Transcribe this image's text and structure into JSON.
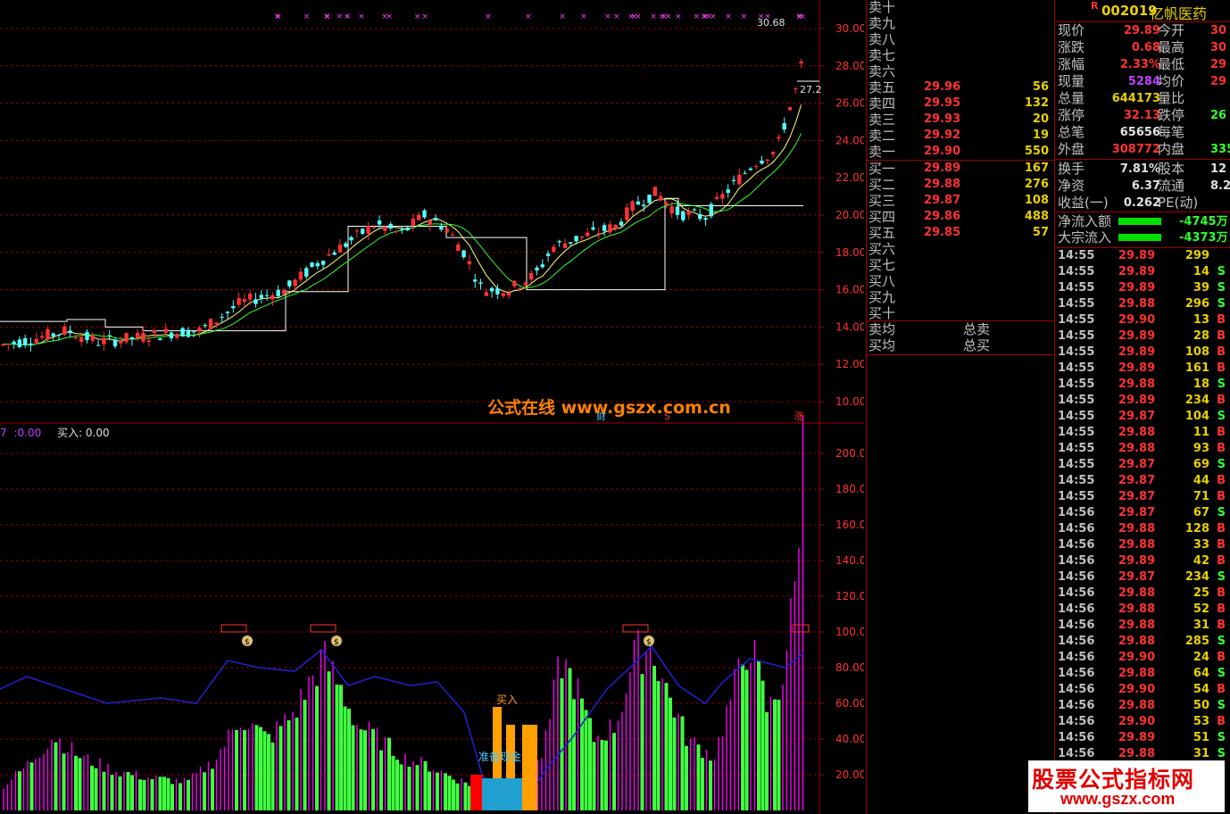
{
  "stock": {
    "flag": "R",
    "code": "002019",
    "name": "亿帆医药"
  },
  "colors": {
    "up": "#ff3232",
    "down": "#54ffff",
    "vol_up": "#ff00ff",
    "grid": "#8b0000",
    "ma1": "#ffff80",
    "ma2": "#30ff30"
  },
  "main_chart": {
    "price_axis": [
      "30.00",
      "28.00",
      "26.00",
      "24.00",
      "22.00",
      "20.00",
      "18.00",
      "16.00",
      "14.00",
      "12.00",
      "10.00"
    ],
    "high_label": "30.68",
    "side_label": "27.2",
    "watermark": "公式在线  www.gszx.com.cn",
    "markers": [
      "财",
      "S",
      "涨"
    ]
  },
  "indicator": {
    "header_a": "7",
    "header_b": ":0.00",
    "header_buy": "买入: 0.00",
    "axis": [
      "200.0",
      "180.0",
      "160.0",
      "140.0",
      "120.0",
      "100.0",
      "80.00",
      "60.00",
      "40.00",
      "20.00"
    ],
    "buy_label": "买入",
    "prepare_label": "准备现金",
    "money_icon": "$"
  },
  "order_book": {
    "sell": [
      {
        "label": "卖十",
        "price": "",
        "vol": ""
      },
      {
        "label": "卖九",
        "price": "",
        "vol": ""
      },
      {
        "label": "卖八",
        "price": "",
        "vol": ""
      },
      {
        "label": "卖七",
        "price": "",
        "vol": ""
      },
      {
        "label": "卖六",
        "price": "",
        "vol": ""
      },
      {
        "label": "卖五",
        "price": "29.96",
        "vol": "56"
      },
      {
        "label": "卖四",
        "price": "29.95",
        "vol": "132"
      },
      {
        "label": "卖三",
        "price": "29.93",
        "vol": "20"
      },
      {
        "label": "卖二",
        "price": "29.92",
        "vol": "19"
      },
      {
        "label": "卖一",
        "price": "29.90",
        "vol": "550"
      }
    ],
    "buy": [
      {
        "label": "买一",
        "price": "29.89",
        "vol": "167"
      },
      {
        "label": "买二",
        "price": "29.88",
        "vol": "276"
      },
      {
        "label": "买三",
        "price": "29.87",
        "vol": "108"
      },
      {
        "label": "买四",
        "price": "29.86",
        "vol": "488"
      },
      {
        "label": "买五",
        "price": "29.85",
        "vol": "57"
      },
      {
        "label": "买六",
        "price": "",
        "vol": ""
      },
      {
        "label": "买七",
        "price": "",
        "vol": ""
      },
      {
        "label": "买八",
        "price": "",
        "vol": ""
      },
      {
        "label": "买九",
        "price": "",
        "vol": ""
      },
      {
        "label": "买十",
        "price": "",
        "vol": ""
      }
    ],
    "sell_avg": "卖均",
    "buy_avg": "买均",
    "total_sell": "总卖",
    "total_buy": "总买"
  },
  "quote": {
    "rows": [
      {
        "l1": "现价",
        "v1": "29.89",
        "c1": "#ff3232",
        "l2": "今开",
        "v2": "30",
        "c2": "#ff3232"
      },
      {
        "l1": "涨跌",
        "v1": "0.68",
        "c1": "#ff3232",
        "l2": "最高",
        "v2": "30",
        "c2": "#ff3232"
      },
      {
        "l1": "涨幅",
        "v1": "2.33%",
        "c1": "#ff3232",
        "l2": "最低",
        "v2": "29",
        "c2": "#ff3232"
      },
      {
        "l1": "现量",
        "v1": "5284",
        "c1": "#c040ff",
        "l2": "均价",
        "v2": "29",
        "c2": "#ff3232"
      },
      {
        "l1": "总量",
        "v1": "644173",
        "c1": "#e8d000",
        "l2": "量比",
        "v2": "",
        "c2": "#e8d000"
      },
      {
        "l1": "涨停",
        "v1": "32.13",
        "c1": "#ff3232",
        "l2": "跌停",
        "v2": "26",
        "c2": "#30ff30"
      },
      {
        "l1": "总笔",
        "v1": "65656",
        "c1": "#e0e0e0",
        "l2": "每笔",
        "v2": "",
        "c2": "#e0e0e0"
      },
      {
        "l1": "外盘",
        "v1": "308772",
        "c1": "#ff3232",
        "l2": "内盘",
        "v2": "335",
        "c2": "#30ff30"
      },
      {
        "l1": "换手",
        "v1": "7.81%",
        "c1": "#e0e0e0",
        "l2": "股本",
        "v2": "12",
        "c2": "#e0e0e0"
      },
      {
        "l1": "净资",
        "v1": "6.37",
        "c1": "#e0e0e0",
        "l2": "流通",
        "v2": "8.2",
        "c2": "#e0e0e0"
      },
      {
        "l1": "收益(一)",
        "v1": "0.262",
        "c1": "#e0e0e0",
        "l2": "PE(动)",
        "v2": "",
        "c2": "#e0e0e0"
      }
    ],
    "net_inflow": {
      "label": "净流入额",
      "value": "-4745万"
    },
    "block_inflow": {
      "label": "大宗流入",
      "value": "-4373万"
    }
  },
  "ticks": [
    [
      "14:55",
      "29.89",
      "299",
      ""
    ],
    [
      "14:55",
      "29.89",
      "14",
      "S"
    ],
    [
      "14:55",
      "29.89",
      "39",
      "S"
    ],
    [
      "14:55",
      "29.88",
      "296",
      "S"
    ],
    [
      "14:55",
      "29.90",
      "13",
      "B"
    ],
    [
      "14:55",
      "29.89",
      "28",
      "B"
    ],
    [
      "14:55",
      "29.89",
      "108",
      "B"
    ],
    [
      "14:55",
      "29.89",
      "161",
      "B"
    ],
    [
      "14:55",
      "29.88",
      "18",
      "S"
    ],
    [
      "14:55",
      "29.89",
      "234",
      "B"
    ],
    [
      "14:55",
      "29.87",
      "104",
      "S"
    ],
    [
      "14:55",
      "29.88",
      "11",
      "B"
    ],
    [
      "14:55",
      "29.88",
      "93",
      "B"
    ],
    [
      "14:55",
      "29.87",
      "69",
      "S"
    ],
    [
      "14:55",
      "29.87",
      "44",
      "B"
    ],
    [
      "14:55",
      "29.87",
      "71",
      "B"
    ],
    [
      "14:56",
      "29.87",
      "67",
      "S"
    ],
    [
      "14:56",
      "29.88",
      "128",
      "B"
    ],
    [
      "14:56",
      "29.88",
      "33",
      "B"
    ],
    [
      "14:56",
      "29.89",
      "42",
      "B"
    ],
    [
      "14:56",
      "29.87",
      "234",
      "S"
    ],
    [
      "14:56",
      "29.88",
      "25",
      "B"
    ],
    [
      "14:56",
      "29.88",
      "52",
      "B"
    ],
    [
      "14:56",
      "29.88",
      "31",
      "B"
    ],
    [
      "14:56",
      "29.88",
      "285",
      "S"
    ],
    [
      "14:56",
      "29.90",
      "24",
      "B"
    ],
    [
      "14:56",
      "29.88",
      "64",
      "S"
    ],
    [
      "14:56",
      "29.90",
      "54",
      "B"
    ],
    [
      "14:56",
      "29.88",
      "50",
      "S"
    ],
    [
      "14:56",
      "29.90",
      "53",
      "B"
    ],
    [
      "14:56",
      "29.89",
      "51",
      "S"
    ],
    [
      "14:56",
      "29.88",
      "31",
      "S"
    ]
  ],
  "banner": {
    "title": "股票公式指标网",
    "url": "www.gszx.com"
  }
}
